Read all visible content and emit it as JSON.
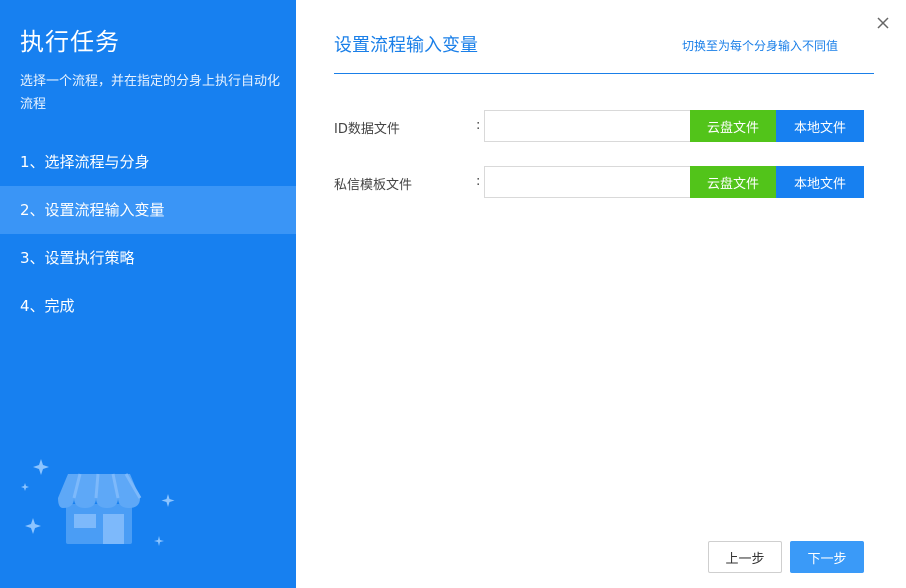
{
  "sidebar": {
    "title": "执行任务",
    "description": "选择一个流程，并在指定的分身上执行自动化流程",
    "steps": [
      {
        "label": "1、选择流程与分身"
      },
      {
        "label": "2、设置流程输入变量"
      },
      {
        "label": "3、设置执行策略"
      },
      {
        "label": "4、完成"
      }
    ],
    "active_step": 2
  },
  "main": {
    "title": "设置流程输入变量",
    "switch_link": "切换至为每个分身输入不同值",
    "fields": [
      {
        "label": "ID数据文件",
        "colon": ":",
        "value": "",
        "cloud_label": "云盘文件",
        "local_label": "本地文件"
      },
      {
        "label": "私信模板文件",
        "colon": ":",
        "value": "",
        "cloud_label": "云盘文件",
        "local_label": "本地文件"
      }
    ]
  },
  "footer": {
    "prev_label": "上一步",
    "next_label": "下一步"
  },
  "colors": {
    "sidebar_bg": "#1780f0",
    "active_step_bg": "#3a95f6",
    "accent": "#1a7fe8",
    "cloud_button": "#52c41a",
    "local_button": "#1780f0",
    "next_button": "#3a9af8"
  },
  "icons": {
    "close": "close-icon",
    "illustration": "store-illustration"
  }
}
